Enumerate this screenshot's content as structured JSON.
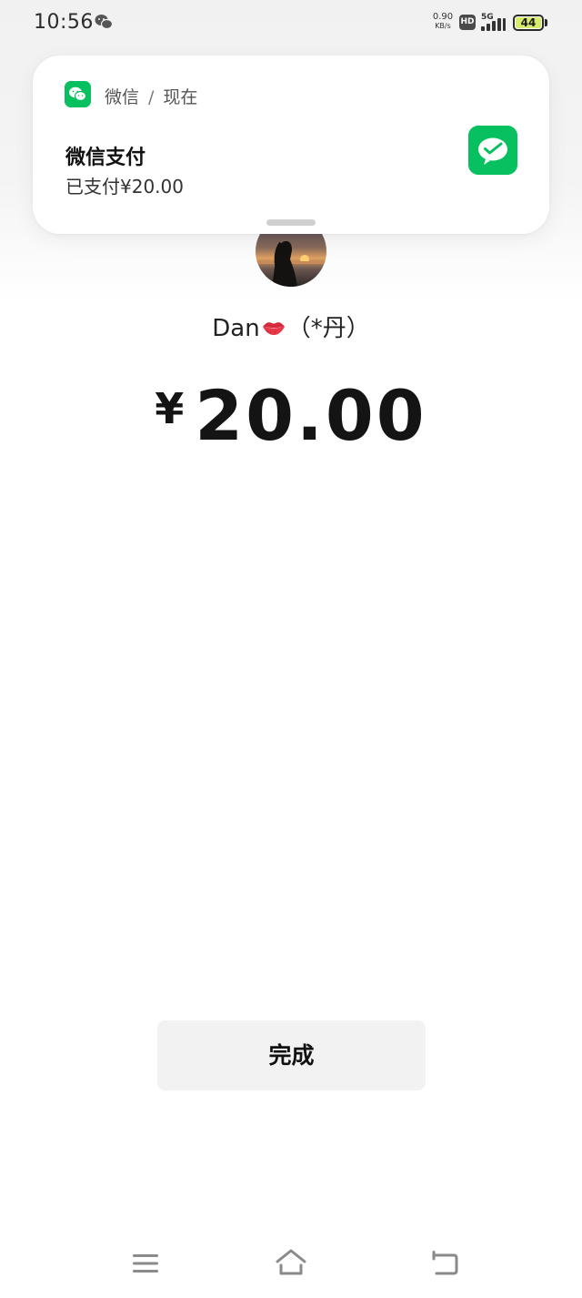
{
  "status_bar": {
    "time": "10:56",
    "net_speed_value": "0.90",
    "net_speed_unit": "KB/s",
    "hd_label": "HD",
    "network_type": "5G",
    "battery": "44",
    "icons": [
      "wechat-icon",
      "hd-icon",
      "signal-icon",
      "battery-icon"
    ]
  },
  "notification": {
    "app_name": "微信",
    "separator": "/",
    "time": "现在",
    "title": "微信支付",
    "body": "已支付¥20.00",
    "icons": [
      "wechat-app-icon",
      "wechat-pay-icon"
    ]
  },
  "payment": {
    "payee": "Dan",
    "payee_suffix": "（*丹）",
    "currency": "¥",
    "amount": "20.00",
    "done_label": "完成"
  },
  "nav_bar": {
    "icons": [
      "menu-icon",
      "home-icon",
      "back-icon"
    ]
  },
  "colors": {
    "wechat_green": "#07c160",
    "battery_fill": "#d7ec6b",
    "button_bg": "#f2f2f2"
  }
}
